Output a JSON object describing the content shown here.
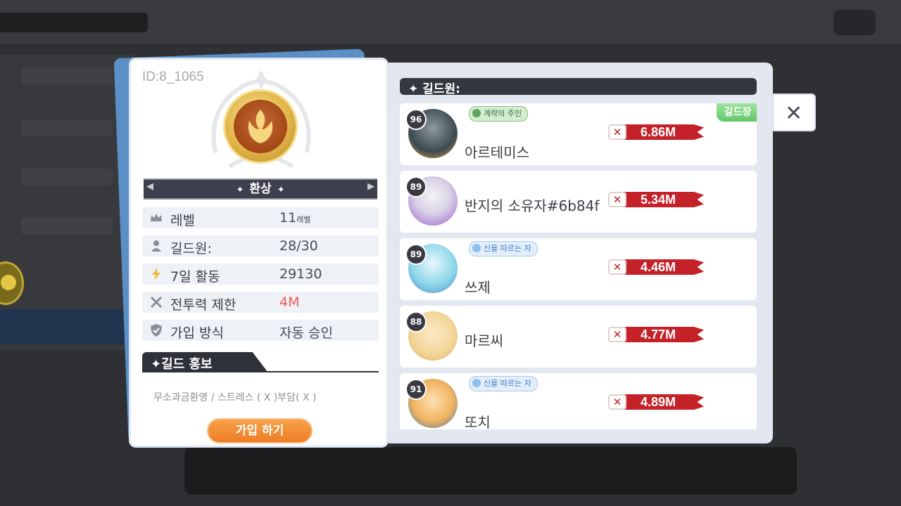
{
  "guild_card": {
    "id": "ID:8_1065",
    "emblem_icon": "phoenix-emblem-icon",
    "name": "환상",
    "info": [
      {
        "icon": "crown-icon",
        "label": "레벨",
        "value": "11",
        "unit": "레벨"
      },
      {
        "icon": "person-icon",
        "label": "길드원:",
        "value": "28/30",
        "unit": ""
      },
      {
        "icon": "lightning-icon",
        "label": "7일 활동",
        "value": "29130",
        "unit": ""
      },
      {
        "icon": "crossed-swords-icon",
        "label": "전투력 제한",
        "value": "4M",
        "unit": ""
      },
      {
        "icon": "shield-icon",
        "label": "가입 방식",
        "value": "자동 승인",
        "unit": ""
      }
    ],
    "promo_title": "✦길드 홍보",
    "promo_text": "무소과금환영 / 스트레스 ( X )부담( X )",
    "join_label": "가입 하기"
  },
  "members_panel": {
    "header": "✦ 길드원:",
    "close_icon": "close-icon",
    "members": [
      {
        "level": "96",
        "name": "아르테미스",
        "title": "계략의 주인",
        "title_style": "green",
        "power": "6.86M",
        "leader": "길드장",
        "avatar_color": "#3c4a52"
      },
      {
        "level": "89",
        "name": "반지의 소유자#6b84f",
        "title": "",
        "title_style": "",
        "power": "5.34M",
        "leader": "",
        "avatar_color": "#b58ad8"
      },
      {
        "level": "89",
        "name": "쓰제",
        "title": "신을 따르는 자",
        "title_style": "blue",
        "power": "4.46M",
        "leader": "",
        "avatar_color": "#8fd7ea"
      },
      {
        "level": "88",
        "name": "마르씨",
        "title": "",
        "title_style": "",
        "power": "4.77M",
        "leader": "",
        "avatar_color": "#f3d69a"
      },
      {
        "level": "91",
        "name": "또치",
        "title": "신을 따르는 자",
        "title_style": "blue",
        "power": "4.89M",
        "leader": "",
        "avatar_color": "#f1b460"
      }
    ]
  }
}
